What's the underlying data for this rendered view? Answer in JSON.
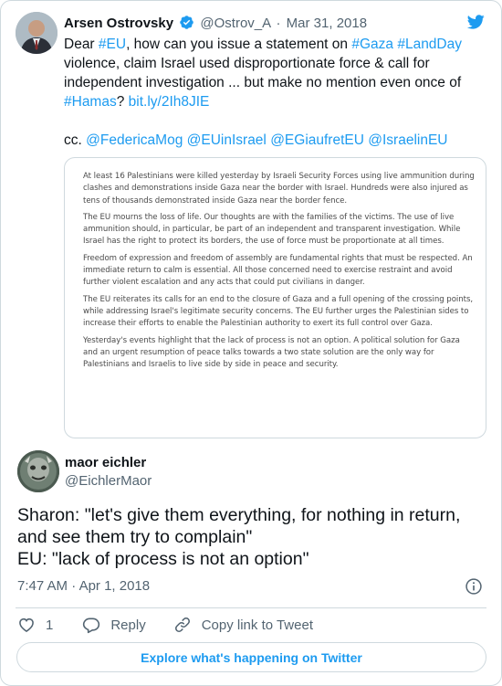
{
  "quoted": {
    "author_name": "Arsen Ostrovsky",
    "handle": "@Ostrov_A",
    "separator": "·",
    "date": "Mar 31, 2018",
    "text": {
      "p1": "Dear ",
      "h_eu": "#EU",
      "p2": ", how can you issue a statement on ",
      "h_gaza": "#Gaza",
      "p3": " ",
      "h_landday": "#LandDay",
      "p4": " violence, claim Israel used disproportionate force & call for independent investigation ... but make no mention even once of ",
      "h_hamas": "#Hamas",
      "p5": "? ",
      "link": "bit.ly/2Ih8JIE",
      "cc_prefix": "cc. ",
      "mentions": [
        "@FedericaMog",
        "@EUinIsrael",
        "@EGiaufretEU",
        "@IsraelinEU"
      ]
    },
    "statement_paragraphs": [
      "At least 16 Palestinians were killed yesterday by Israeli Security Forces using live ammunition during clashes and demonstrations inside Gaza near the border with Israel. Hundreds were also injured as tens of thousands demonstrated inside Gaza near the border fence.",
      "The EU mourns the loss of life. Our thoughts are with the families of the victims. The use of live ammunition should, in particular, be part of an independent and transparent investigation. While Israel has the right to protect its borders, the use of force must be proportionate at all times.",
      "Freedom of expression and freedom of assembly are fundamental rights that must be respected. An immediate return to calm is essential. All those concerned need to exercise restraint and avoid further violent escalation and any acts that could put civilians in danger.",
      "The EU reiterates its calls for an end to the closure of Gaza and a full opening of the crossing points, while addressing Israel's legitimate security concerns. The EU further urges the Palestinian sides to increase their efforts to enable the Palestinian authority to exert its full control over Gaza.",
      "Yesterday's events highlight that the lack of process is not an option. A political solution for Gaza and an urgent resumption of peace talks towards a two state solution are the only way for Palestinians and Israelis to live side by side in peace and security."
    ]
  },
  "tweet": {
    "author_name": "maor eichler",
    "handle": "@EichlerMaor",
    "line1": "Sharon: \"let's give them everything, for nothing in return, and see them try to complain\"",
    "line2": "EU: \"lack of process is not an option\"",
    "time": "7:47 AM",
    "separator": "·",
    "date": "Apr 1, 2018"
  },
  "actions": {
    "like_count": "1",
    "reply_label": "Reply",
    "copy_label": "Copy link to Tweet"
  },
  "explore_label": "Explore what's happening on Twitter",
  "colors": {
    "link": "#1d9bf0",
    "text": "#0f1419",
    "secondary": "#536471",
    "border": "#cfd9de"
  },
  "icons": [
    "twitter-bird-icon",
    "verified-badge-icon",
    "info-icon",
    "heart-icon",
    "reply-bubble-icon",
    "link-icon"
  ]
}
